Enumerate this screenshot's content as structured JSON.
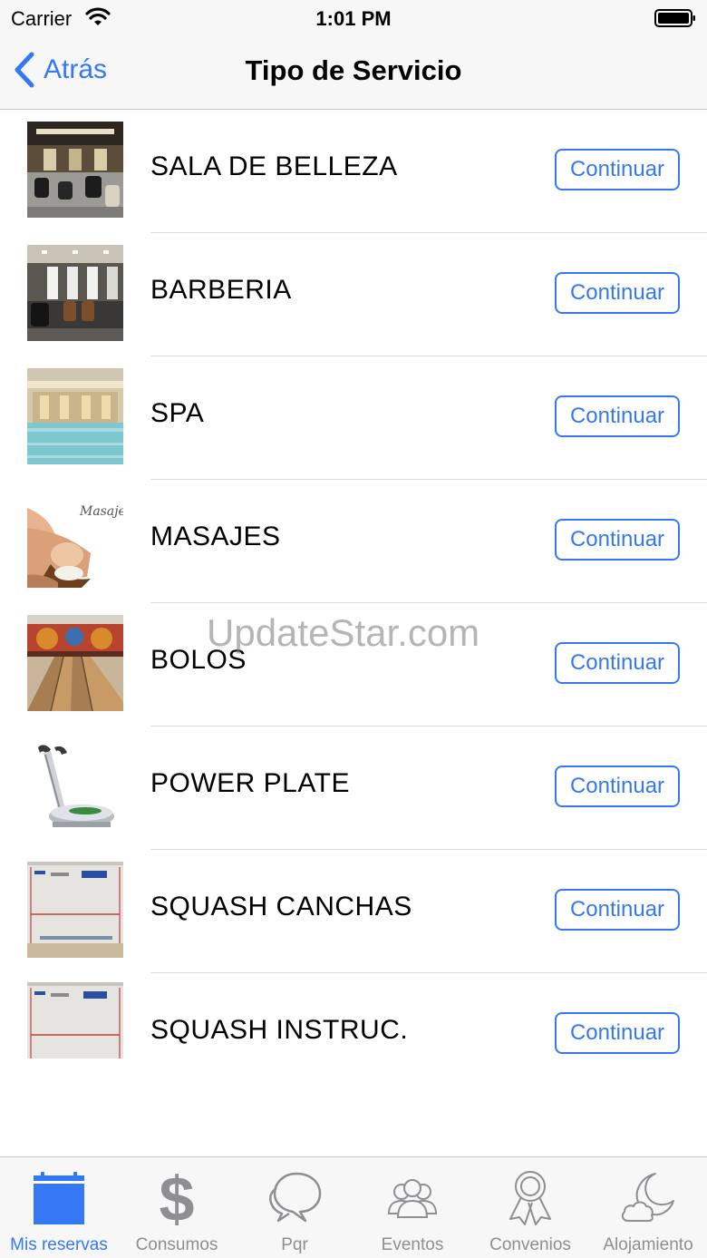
{
  "status_bar": {
    "carrier": "Carrier",
    "time": "1:01 PM"
  },
  "nav": {
    "back_label": "Atrás",
    "title": "Tipo de Servicio"
  },
  "services": [
    {
      "title": "SALA DE BELLEZA",
      "button": "Continuar",
      "image": "beauty-salon"
    },
    {
      "title": "BARBERIA",
      "button": "Continuar",
      "image": "barbershop"
    },
    {
      "title": "SPA",
      "button": "Continuar",
      "image": "spa-pool"
    },
    {
      "title": "MASAJES",
      "button": "Continuar",
      "image": "massage",
      "image_caption": "Masajes"
    },
    {
      "title": "BOLOS",
      "button": "Continuar",
      "image": "bowling-alley"
    },
    {
      "title": "POWER PLATE",
      "button": "Continuar",
      "image": "power-plate-machine"
    },
    {
      "title": "SQUASH CANCHAS",
      "button": "Continuar",
      "image": "squash-court"
    },
    {
      "title": "SQUASH INSTRUC.",
      "button": "Continuar",
      "image": "squash-court"
    }
  ],
  "watermark": "UpdateStar.com",
  "tabs": [
    {
      "label": "Mis reservas",
      "icon": "calendar-icon",
      "active": true
    },
    {
      "label": "Consumos",
      "icon": "dollar-icon"
    },
    {
      "label": "Pqr",
      "icon": "chat-bubbles-icon"
    },
    {
      "label": "Eventos",
      "icon": "people-icon"
    },
    {
      "label": "Convenios",
      "icon": "award-ribbon-icon"
    },
    {
      "label": "Alojamiento",
      "icon": "moon-cloud-icon"
    }
  ],
  "colors": {
    "accent": "#3478f6",
    "inactive": "#8e8e93",
    "bar_background": "#f7f7f7"
  }
}
